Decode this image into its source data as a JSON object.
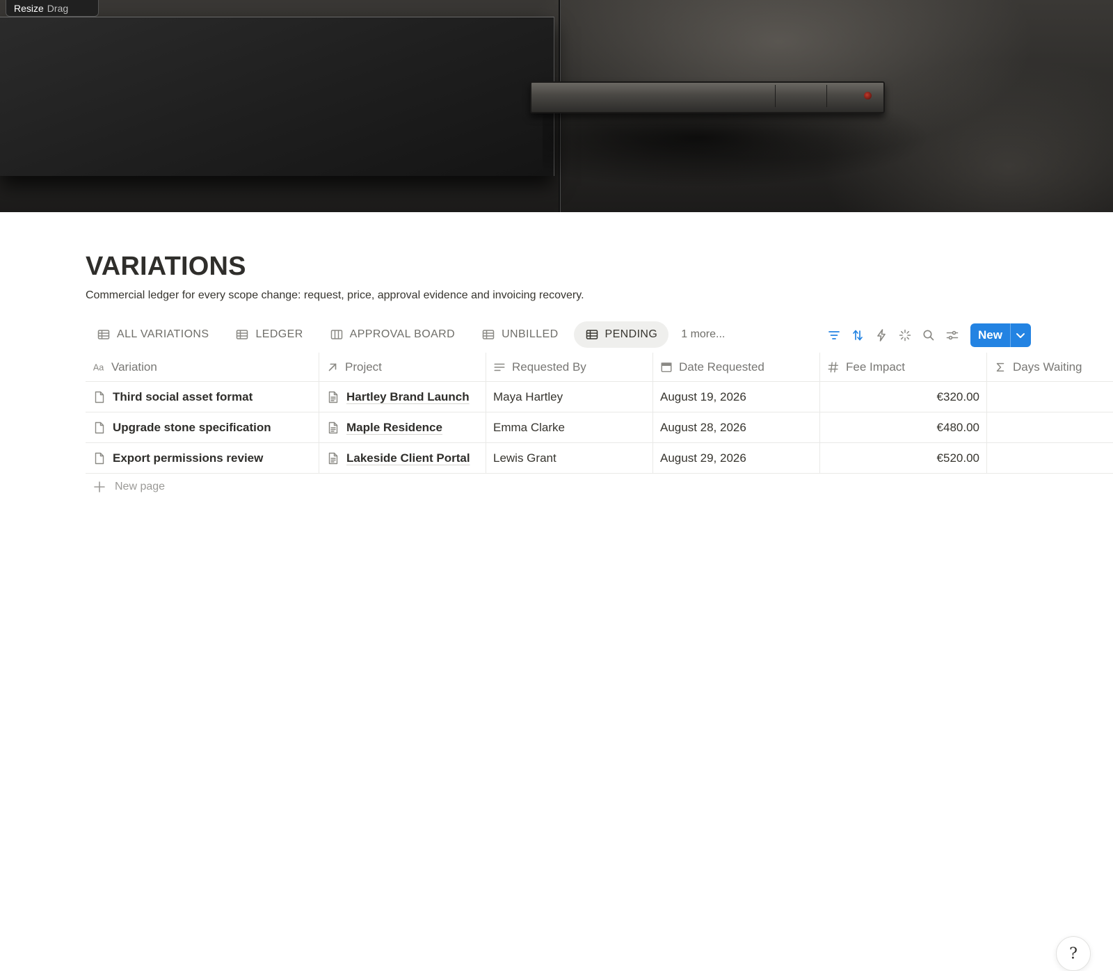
{
  "cover": {
    "badge": {
      "resize": "Resize",
      "drag": "Drag"
    }
  },
  "page": {
    "title": "VARIATIONS",
    "description": "Commercial ledger for every scope change: request, price, approval evidence and invoicing recovery."
  },
  "views": {
    "tabs": [
      {
        "label": "ALL VARIATIONS",
        "icon": "table-icon"
      },
      {
        "label": "LEDGER",
        "icon": "table-icon"
      },
      {
        "label": "APPROVAL BOARD",
        "icon": "board-icon"
      },
      {
        "label": "UNBILLED",
        "icon": "table-icon"
      },
      {
        "label": "PENDING",
        "icon": "table-icon",
        "active": true
      }
    ],
    "more": "1 more..."
  },
  "toolbar": {
    "new_label": "New",
    "accent": "#2383e2",
    "icons": [
      "filter-icon",
      "sort-icon",
      "automation-bolt-icon",
      "ai-sparkle-icon",
      "search-icon",
      "settings-sliders-icon"
    ]
  },
  "table": {
    "columns": [
      {
        "label": "Variation",
        "icon": "text-aa-icon"
      },
      {
        "label": "Project",
        "icon": "relation-arrow-icon"
      },
      {
        "label": "Requested By",
        "icon": "text-lines-icon"
      },
      {
        "label": "Date Requested",
        "icon": "calendar-icon"
      },
      {
        "label": "Fee Impact",
        "icon": "number-hash-icon"
      },
      {
        "label": "Days Waiting",
        "icon": "formula-sigma-icon"
      }
    ],
    "rows": [
      {
        "variation": "Third social asset format",
        "project": "Hartley Brand Launch",
        "requested_by": "Maya Hartley",
        "date": "August 19, 2026",
        "fee": "€320.00",
        "days": ""
      },
      {
        "variation": "Upgrade stone specification",
        "project": "Maple Residence",
        "requested_by": "Emma Clarke",
        "date": "August 28, 2026",
        "fee": "€480.00",
        "days": ""
      },
      {
        "variation": "Export permissions review",
        "project": "Lakeside Client Portal",
        "requested_by": "Lewis Grant",
        "date": "August 29, 2026",
        "fee": "€520.00",
        "days": ""
      }
    ],
    "new_page": "New page"
  },
  "help": {
    "glyph": "?"
  }
}
